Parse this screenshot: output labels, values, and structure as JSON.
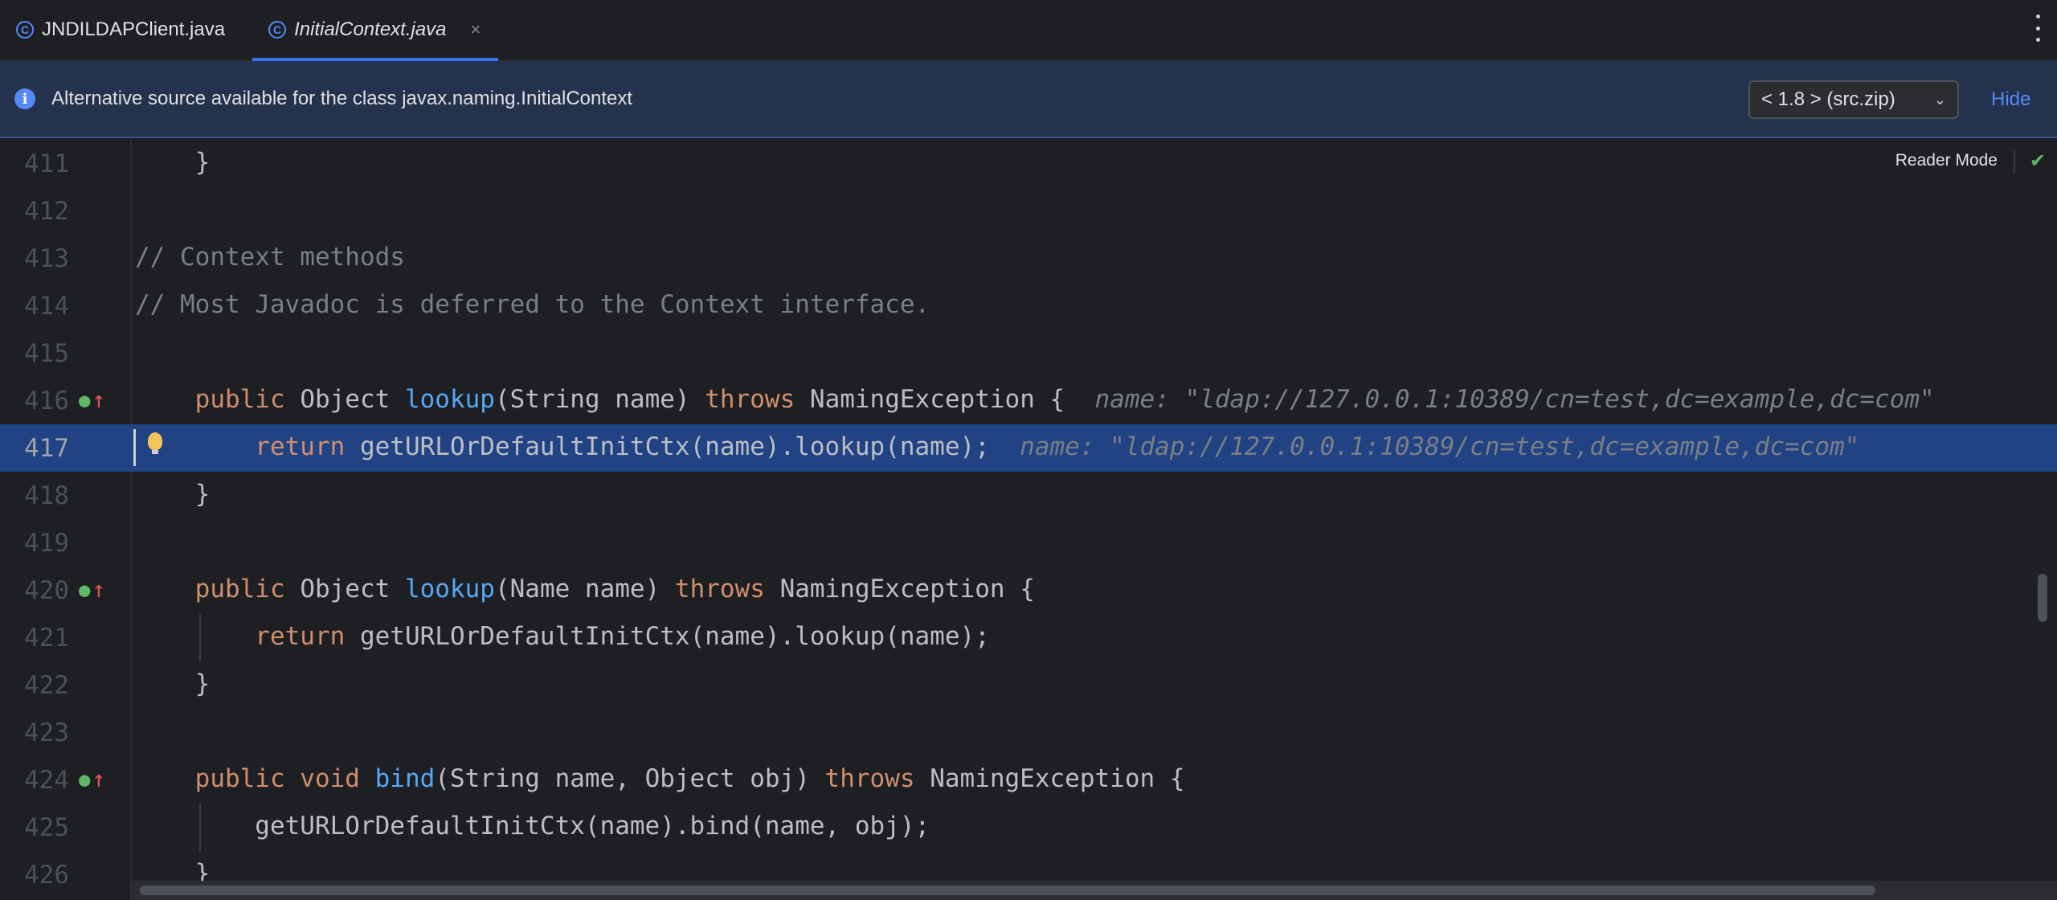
{
  "tabs": [
    {
      "label": "JNDILDAPClient.java",
      "active": false
    },
    {
      "label": "InitialContext.java",
      "active": true
    }
  ],
  "tab_close_glyph": "×",
  "banner": {
    "message": "Alternative source available for the class javax.naming.InitialContext",
    "selected_source": "< 1.8 > (src.zip)",
    "hide_label": "Hide"
  },
  "editor": {
    "reader_mode_label": "Reader Mode",
    "current_line": 417,
    "lines": [
      {
        "num": "411",
        "tokens": [
          [
            "",
            "    }"
          ]
        ]
      },
      {
        "num": "412",
        "tokens": []
      },
      {
        "num": "413",
        "tokens": [
          [
            "cm",
            "// Context methods"
          ]
        ]
      },
      {
        "num": "414",
        "tokens": [
          [
            "cm",
            "// Most Javadoc is deferred to the Context interface."
          ]
        ]
      },
      {
        "num": "415",
        "tokens": []
      },
      {
        "num": "416",
        "mark": true,
        "tokens": [
          [
            "kw",
            "    public "
          ],
          [
            "",
            "Object "
          ],
          [
            "fn",
            "lookup"
          ],
          [
            "",
            "(String name) "
          ],
          [
            "kw",
            "throws "
          ],
          [
            "",
            "NamingException {  "
          ],
          [
            "hint",
            "name: \"ldap://127.0.0.1:10389/cn=test,dc=example,dc=com\""
          ]
        ]
      },
      {
        "num": "417",
        "current": true,
        "bulb": true,
        "tokens": [
          [
            "kw",
            "        return "
          ],
          [
            "",
            "getURLOrDefaultInitCtx(name).lookup(name);  "
          ],
          [
            "hint",
            "name: \"ldap://127.0.0.1:10389/cn=test,dc=example,dc=com\""
          ]
        ]
      },
      {
        "num": "418",
        "tokens": [
          [
            "",
            "    }"
          ]
        ]
      },
      {
        "num": "419",
        "tokens": []
      },
      {
        "num": "420",
        "mark": true,
        "tokens": [
          [
            "kw",
            "    public "
          ],
          [
            "",
            "Object "
          ],
          [
            "fn",
            "lookup"
          ],
          [
            "",
            "(Name name) "
          ],
          [
            "kw",
            "throws "
          ],
          [
            "",
            "NamingException {"
          ]
        ]
      },
      {
        "num": "421",
        "guide": true,
        "tokens": [
          [
            "kw",
            "        return "
          ],
          [
            "",
            "getURLOrDefaultInitCtx(name).lookup(name);"
          ]
        ]
      },
      {
        "num": "422",
        "tokens": [
          [
            "",
            "    }"
          ]
        ]
      },
      {
        "num": "423",
        "tokens": []
      },
      {
        "num": "424",
        "mark": true,
        "tokens": [
          [
            "kw",
            "    public void "
          ],
          [
            "fn",
            "bind"
          ],
          [
            "",
            "(String name, Object obj) "
          ],
          [
            "kw",
            "throws "
          ],
          [
            "",
            "NamingException {"
          ]
        ]
      },
      {
        "num": "425",
        "guide": true,
        "tokens": [
          [
            "",
            "        getURLOrDefaultInitCtx(name).bind(name, obj);"
          ]
        ]
      },
      {
        "num": "426",
        "tokens": [
          [
            "",
            "    }"
          ]
        ]
      }
    ]
  },
  "icons": {
    "tab_icon": "class-c-icon",
    "info": "info-icon",
    "check": "check-icon",
    "kebab": "more-vertical-icon",
    "override": "override-up-icon",
    "bulb": "lightbulb-icon"
  }
}
